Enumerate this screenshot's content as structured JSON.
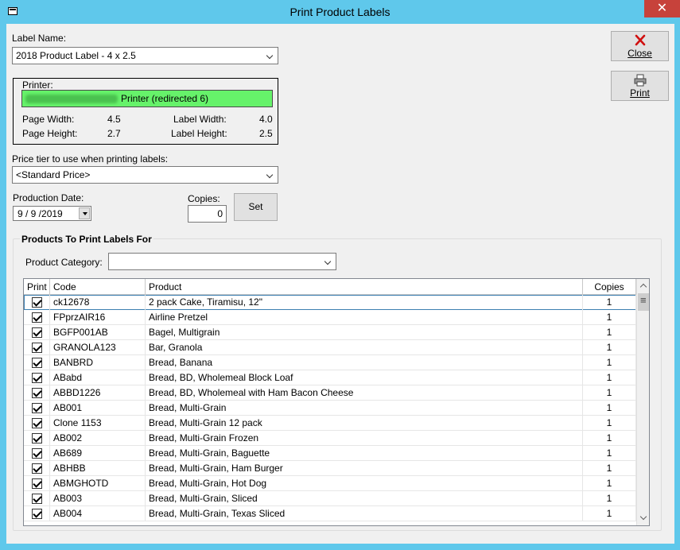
{
  "window": {
    "title": "Print Product Labels",
    "close_glyph": "✕"
  },
  "label_name": {
    "label": "Label Name:",
    "value": "2018 Product Label - 4 x 2.5"
  },
  "printer": {
    "label": "Printer:",
    "value": "Printer (redirected 6)",
    "highlight_color": "#66f26a",
    "page_width_label": "Page Width:",
    "page_width": "4.5",
    "page_height_label": "Page Height:",
    "page_height": "2.7",
    "label_width_label": "Label Width:",
    "label_width": "4.0",
    "label_height_label": "Label Height:",
    "label_height": "2.5"
  },
  "price_tier": {
    "label": "Price tier to use when printing labels:",
    "value": "<Standard Price>"
  },
  "production_date": {
    "label": "Production Date:",
    "value": "9 / 9 /2019"
  },
  "copies": {
    "label": "Copies:",
    "value": "0"
  },
  "buttons": {
    "close": "Close",
    "print": "Print",
    "set": "Set"
  },
  "products": {
    "group_title": "Products To Print Labels For",
    "category_label": "Product Category:",
    "category_value": "",
    "columns": [
      "Print",
      "Code",
      "Product",
      "Copies"
    ],
    "rows": [
      {
        "print": true,
        "code": "ck12678",
        "product": "2 pack Cake, Tiramisu, 12\"",
        "copies": "1"
      },
      {
        "print": true,
        "code": "FPprzAIR16",
        "product": "Airline Pretzel",
        "copies": "1"
      },
      {
        "print": true,
        "code": "BGFP001AB",
        "product": "Bagel, Multigrain",
        "copies": "1"
      },
      {
        "print": true,
        "code": "GRANOLA123",
        "product": "Bar, Granola",
        "copies": "1"
      },
      {
        "print": true,
        "code": "BANBRD",
        "product": "Bread, Banana",
        "copies": "1"
      },
      {
        "print": true,
        "code": "ABabd",
        "product": "Bread, BD, Wholemeal Block Loaf",
        "copies": "1"
      },
      {
        "print": true,
        "code": "ABBD1226",
        "product": "Bread, BD, Wholemeal with Ham Bacon Cheese",
        "copies": "1"
      },
      {
        "print": true,
        "code": "AB001",
        "product": "Bread, Multi-Grain",
        "copies": "1"
      },
      {
        "print": true,
        "code": "Clone 1153",
        "product": "Bread, Multi-Grain 12 pack",
        "copies": "1"
      },
      {
        "print": true,
        "code": "AB002",
        "product": "Bread, Multi-Grain Frozen",
        "copies": "1"
      },
      {
        "print": true,
        "code": "AB689",
        "product": "Bread, Multi-Grain, Baguette",
        "copies": "1"
      },
      {
        "print": true,
        "code": "ABHBB",
        "product": "Bread, Multi-Grain, Ham Burger",
        "copies": "1"
      },
      {
        "print": true,
        "code": "ABMGHOTD",
        "product": "Bread, Multi-Grain, Hot Dog",
        "copies": "1"
      },
      {
        "print": true,
        "code": "AB003",
        "product": "Bread, Multi-Grain, Sliced",
        "copies": "1"
      },
      {
        "print": true,
        "code": "AB004",
        "product": "Bread, Multi-Grain, Texas Sliced",
        "copies": "1"
      }
    ]
  }
}
